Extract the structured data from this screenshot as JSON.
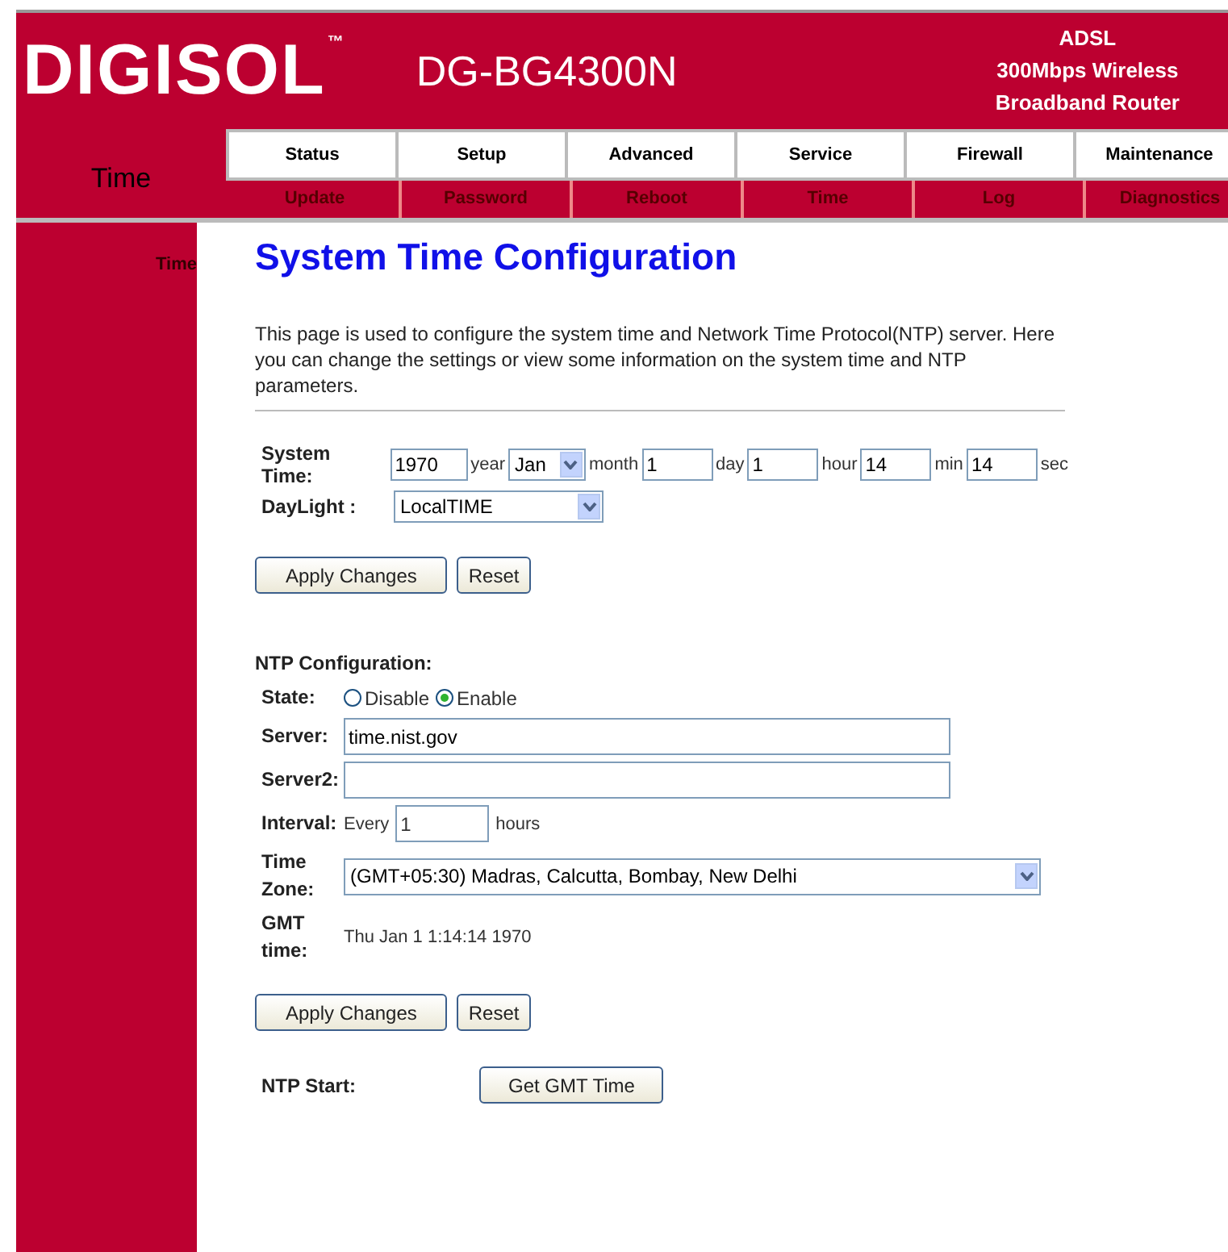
{
  "header": {
    "logo": "DIGISOL",
    "trademark": "™",
    "model": "DG-BG4300N",
    "product_lines": [
      "ADSL",
      "300Mbps Wireless",
      "Broadband Router"
    ]
  },
  "section_title": "Time",
  "menu": [
    {
      "label": "Status"
    },
    {
      "label": "Setup"
    },
    {
      "label": "Advanced"
    },
    {
      "label": "Service"
    },
    {
      "label": "Firewall"
    },
    {
      "label": "Maintenance"
    }
  ],
  "submenu": [
    {
      "label": "Update"
    },
    {
      "label": "Password"
    },
    {
      "label": "Reboot"
    },
    {
      "label": "Time"
    },
    {
      "label": "Log"
    },
    {
      "label": "Diagnostics"
    }
  ],
  "sidebar": {
    "items": [
      {
        "label": "Time"
      }
    ]
  },
  "page": {
    "title": "System Time Configuration",
    "description": "This page is used to configure the system time and Network Time Protocol(NTP) server. Here you can change the settings or view some information on the system time and NTP parameters."
  },
  "system_time": {
    "label": "System Time:",
    "fields": [
      {
        "kind": "input",
        "value": "1970",
        "unit": "year"
      },
      {
        "kind": "select",
        "value": "Jan",
        "unit": "month"
      },
      {
        "kind": "input",
        "value": "1",
        "unit": "day"
      },
      {
        "kind": "input",
        "value": "1",
        "unit": "hour"
      },
      {
        "kind": "input",
        "value": "14",
        "unit": "min"
      },
      {
        "kind": "input",
        "value": "14",
        "unit": "sec"
      }
    ]
  },
  "daylight": {
    "label": "DayLight :",
    "value": "LocalTIME"
  },
  "buttons_1": [
    "Apply Changes",
    "Reset"
  ],
  "ntp": {
    "heading": "NTP Configuration:",
    "state": {
      "label": "State:",
      "options": [
        {
          "label": "Disable",
          "selected": false
        },
        {
          "label": "Enable",
          "selected": true
        }
      ]
    },
    "server": {
      "label": "Server:",
      "value": "time.nist.gov"
    },
    "server2": {
      "label": "Server2:"
    },
    "interval": {
      "label": "Interval:",
      "prefix": "Every",
      "value": "1",
      "suffix": "hours"
    },
    "time_zone": {
      "label": "Time Zone:",
      "value": "(GMT+05:30) Madras, Calcutta, Bombay, New Delhi"
    },
    "gmt_time": {
      "label": "GMT time:",
      "value": "Thu Jan 1 1:14:14 1970"
    }
  },
  "buttons_2": [
    "Apply Changes",
    "Reset"
  ],
  "ntp_start": {
    "label": "NTP Start:",
    "button": "Get GMT Time"
  }
}
